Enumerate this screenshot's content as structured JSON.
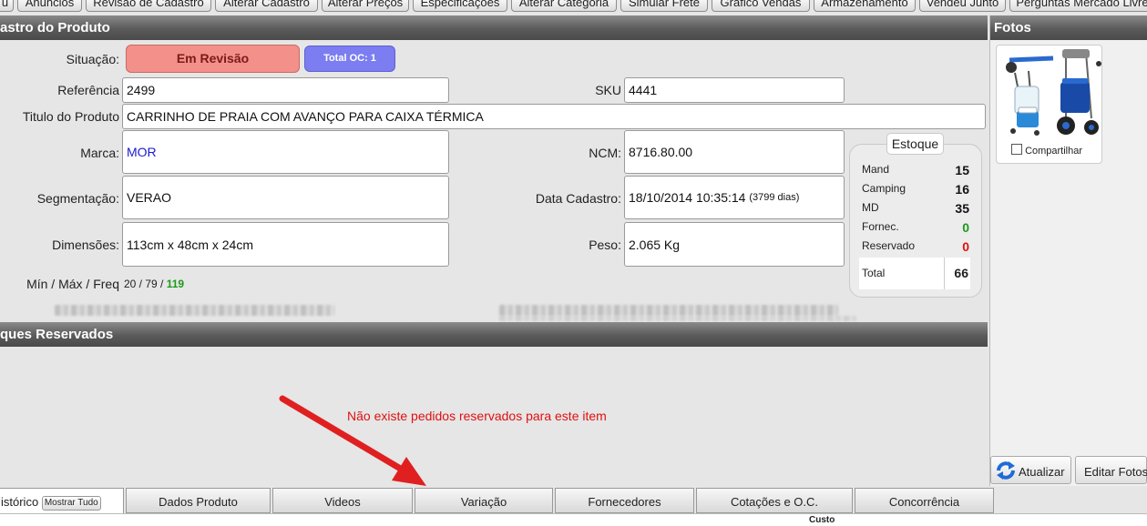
{
  "top_tabs": [
    "u",
    "Anúncios",
    "Revisão de Cadastro",
    "Alterar Cadastro",
    "Alterar Preços",
    "Especificações",
    "Alterar Categoria",
    "Simular Frete",
    "Gráfico Vendas",
    "Armazenamento",
    "Vendeu Junto",
    "Perguntas Mercado Livre"
  ],
  "cadastro": {
    "header": "astro do Produto",
    "situacao_label": "Situação:",
    "situacao_value": "Em Revisão",
    "total_oc": "Total OC: 1",
    "referencia_label": "Referência",
    "referencia_value": "2499",
    "sku_label": "SKU",
    "sku_value": "4441",
    "titulo_label": "Titulo do Produto",
    "titulo_value": "CARRINHO DE PRAIA COM AVANÇO PARA CAIXA TÉRMICA",
    "marca_label": "Marca:",
    "marca_value": "MOR",
    "ncm_label": "NCM:",
    "ncm_value": "8716.80.00",
    "segmentacao_label": "Segmentação:",
    "segmentacao_value": "VERAO",
    "data_label": "Data Cadastro:",
    "data_value": "18/10/2014 10:35:14",
    "data_days": "(3799 dias)",
    "dimensoes_label": "Dimensões:",
    "dimensoes_value": "113cm x 48cm x 24cm",
    "peso_label": "Peso:",
    "peso_value": "2.065 Kg",
    "minmax_label": "Mín / Máx / Freq",
    "min_max": "20 / 79 / ",
    "freq": "119"
  },
  "estoque": {
    "title": "Estoque",
    "rows": [
      {
        "label": "Mand",
        "value": "15",
        "color": "#111111"
      },
      {
        "label": "Camping",
        "value": "16",
        "color": "#111111"
      },
      {
        "label": "MD",
        "value": "35",
        "color": "#111111"
      },
      {
        "label": "Fornec.",
        "value": "0",
        "color": "#1a9a1a"
      },
      {
        "label": "Reservado",
        "value": "0",
        "color": "#e01010"
      }
    ],
    "total_label": "Total",
    "total_value": "66"
  },
  "fotos": {
    "header": "Fotos",
    "share_label": "Compartilhar",
    "atualizar": "Atualizar",
    "editar": "Editar Fotos"
  },
  "reservados": {
    "header": "ques Reservados",
    "empty_message": "Não existe pedidos reservados para este item"
  },
  "bottom_tabs": {
    "historico": "istórico",
    "mostrar_tudo": "Mostrar Tudo",
    "dados": "Dados Produto",
    "videos": "Videos",
    "variacao": "Variação",
    "fornecedores": "Fornecedores",
    "cotacoes": "Cotações e O.C.",
    "concorrencia": "Concorrência"
  },
  "table_header": {
    "custo": "Custo"
  },
  "colors": {
    "status_bg": "#f4908a",
    "oc_bg": "#7b7df0",
    "brand_link": "#1a1ad0",
    "freq_green": "#1a9a1a",
    "message_red": "#e01010",
    "arrow_red": "#e02020"
  }
}
